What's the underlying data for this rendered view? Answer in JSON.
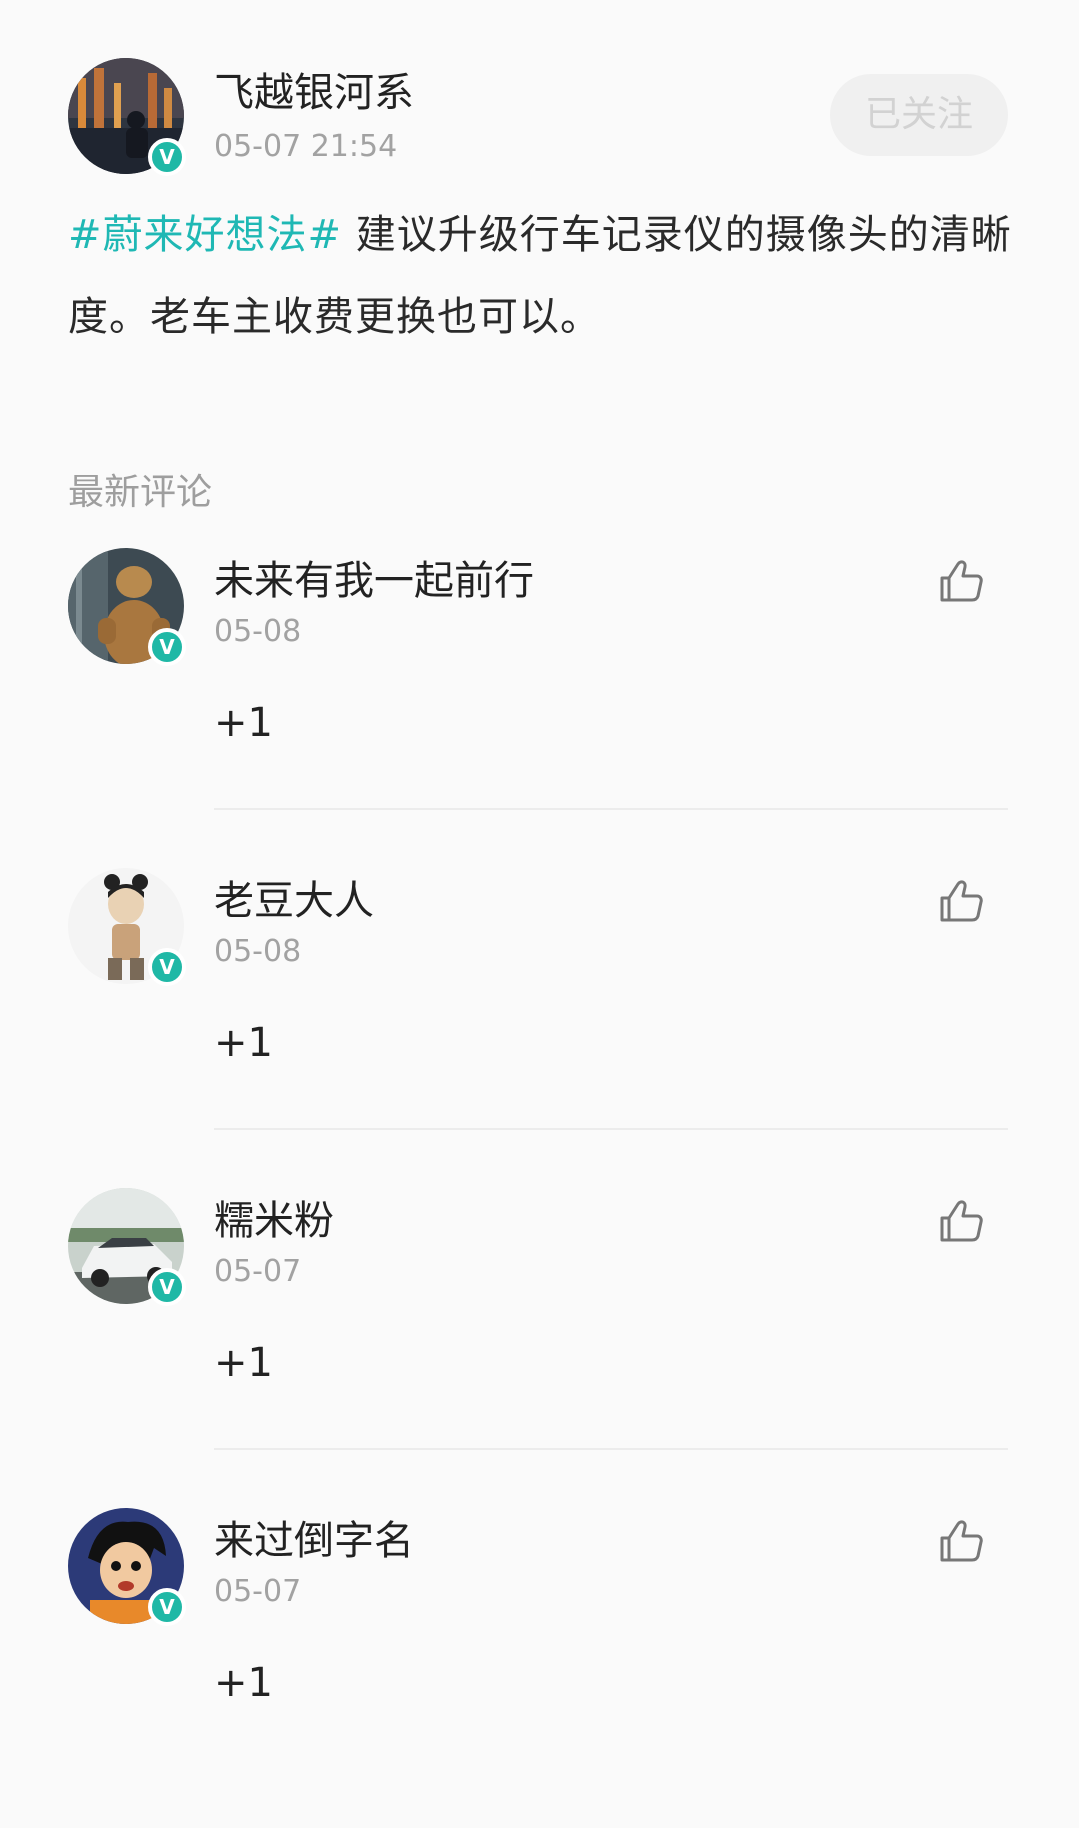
{
  "post": {
    "author": {
      "name": "飞越银河系",
      "time": "05-07 21:54",
      "avatar": "city-night-avatar",
      "verified_label": "V"
    },
    "follow_button": {
      "label": "已关注"
    },
    "text": {
      "hashtag": "#蔚来好想法#",
      "body": " 建议升级行车记录仪的摄像头的清晰度。老车主收费更换也可以。"
    }
  },
  "comments_section": {
    "title": "最新评论"
  },
  "comments": [
    {
      "name": "未来有我一起前行",
      "date": "05-08",
      "text": "+1",
      "avatar": "muscle-dog-avatar",
      "verified_label": "V",
      "like_icon": "thumbs-up-icon"
    },
    {
      "name": "老豆大人",
      "date": "05-08",
      "text": "+1",
      "avatar": "cartoon-character-avatar",
      "verified_label": "V",
      "like_icon": "thumbs-up-icon"
    },
    {
      "name": "糯米粉",
      "date": "05-07",
      "text": "+1",
      "avatar": "white-car-avatar",
      "verified_label": "V",
      "like_icon": "thumbs-up-icon"
    },
    {
      "name": "来过倒字名",
      "date": "05-07",
      "text": "+1",
      "avatar": "anime-boy-avatar",
      "verified_label": "V",
      "like_icon": "thumbs-up-icon"
    }
  ],
  "colors": {
    "accent": "#1fb8b4",
    "badge": "#1fb8a6",
    "muted_text": "#a2a2a2",
    "background": "#fafafa"
  }
}
